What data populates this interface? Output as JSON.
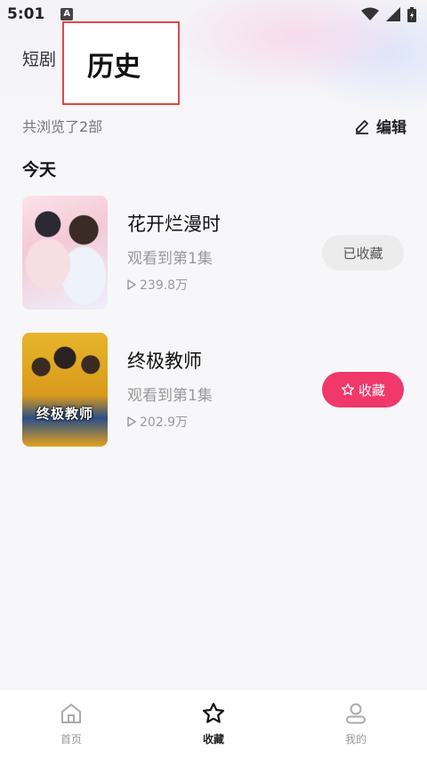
{
  "status_bar": {
    "time": "5:01",
    "notification_badge": "A"
  },
  "tabs": {
    "short_drama": "短剧",
    "history": "历史"
  },
  "summary": {
    "count_text": "共浏览了2部",
    "edit_label": "编辑"
  },
  "section_title": "今天",
  "dramas": [
    {
      "title": "花开烂漫时",
      "progress": "观看到第1集",
      "views": "239.8万",
      "fav_label": "已收藏",
      "favorited": true
    },
    {
      "title": "终极教师",
      "progress": "观看到第1集",
      "views": "202.9万",
      "fav_label": "收藏",
      "favorited": false,
      "poster_text": "终极教师"
    }
  ],
  "bottom_nav": [
    {
      "label": "首页",
      "icon": "home-icon",
      "active": false
    },
    {
      "label": "收藏",
      "icon": "star-icon",
      "active": true
    },
    {
      "label": "我的",
      "icon": "user-icon",
      "active": false
    }
  ],
  "colors": {
    "accent": "#f0386b",
    "highlight_border": "#e04848"
  }
}
